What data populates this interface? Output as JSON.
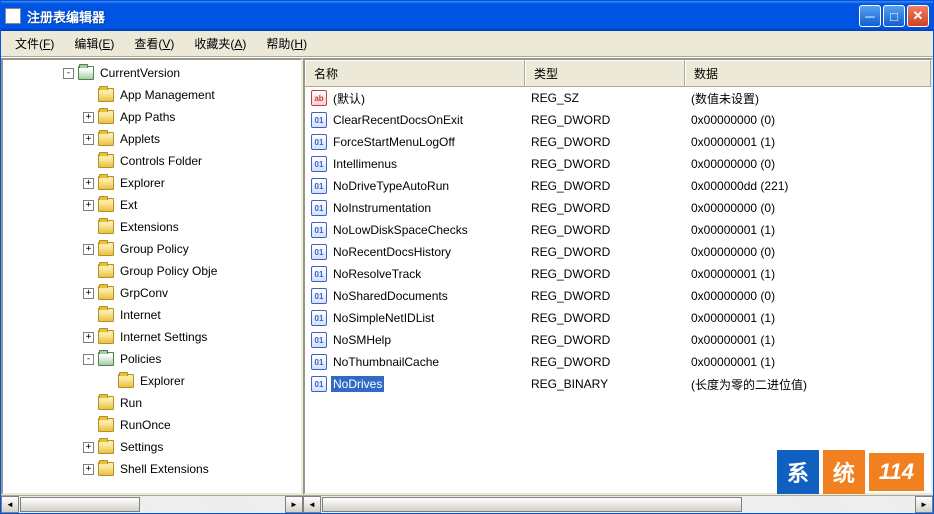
{
  "window": {
    "title": "注册表编辑器"
  },
  "menu": [
    {
      "label": "文件",
      "key": "F"
    },
    {
      "label": "编辑",
      "key": "E"
    },
    {
      "label": "查看",
      "key": "V"
    },
    {
      "label": "收藏夹",
      "key": "A"
    },
    {
      "label": "帮助",
      "key": "H"
    }
  ],
  "tree": [
    {
      "depth": 1,
      "toggle": "-",
      "open": true,
      "label": "CurrentVersion"
    },
    {
      "depth": 2,
      "toggle": "",
      "open": false,
      "label": "App Management"
    },
    {
      "depth": 2,
      "toggle": "+",
      "open": false,
      "label": "App Paths"
    },
    {
      "depth": 2,
      "toggle": "+",
      "open": false,
      "label": "Applets"
    },
    {
      "depth": 2,
      "toggle": "",
      "open": false,
      "label": "Controls Folder"
    },
    {
      "depth": 2,
      "toggle": "+",
      "open": false,
      "label": "Explorer"
    },
    {
      "depth": 2,
      "toggle": "+",
      "open": false,
      "label": "Ext"
    },
    {
      "depth": 2,
      "toggle": "",
      "open": false,
      "label": "Extensions"
    },
    {
      "depth": 2,
      "toggle": "+",
      "open": false,
      "label": "Group Policy"
    },
    {
      "depth": 2,
      "toggle": "",
      "open": false,
      "label": "Group Policy Obje"
    },
    {
      "depth": 2,
      "toggle": "+",
      "open": false,
      "label": "GrpConv"
    },
    {
      "depth": 2,
      "toggle": "",
      "open": false,
      "label": "Internet"
    },
    {
      "depth": 2,
      "toggle": "+",
      "open": false,
      "label": "Internet Settings"
    },
    {
      "depth": 2,
      "toggle": "-",
      "open": true,
      "label": "Policies"
    },
    {
      "depth": 3,
      "toggle": "",
      "open": false,
      "label": "Explorer"
    },
    {
      "depth": 2,
      "toggle": "",
      "open": false,
      "label": "Run"
    },
    {
      "depth": 2,
      "toggle": "",
      "open": false,
      "label": "RunOnce"
    },
    {
      "depth": 2,
      "toggle": "+",
      "open": false,
      "label": "Settings"
    },
    {
      "depth": 2,
      "toggle": "+",
      "open": false,
      "label": "Shell Extensions"
    }
  ],
  "columns": {
    "name": "名称",
    "type": "类型",
    "data": "数据"
  },
  "values": [
    {
      "icon": "sz",
      "name": "(默认)",
      "type": "REG_SZ",
      "data": "(数值未设置)",
      "selected": false
    },
    {
      "icon": "bin",
      "name": "ClearRecentDocsOnExit",
      "type": "REG_DWORD",
      "data": "0x00000000 (0)",
      "selected": false
    },
    {
      "icon": "bin",
      "name": "ForceStartMenuLogOff",
      "type": "REG_DWORD",
      "data": "0x00000001 (1)",
      "selected": false
    },
    {
      "icon": "bin",
      "name": "Intellimenus",
      "type": "REG_DWORD",
      "data": "0x00000000 (0)",
      "selected": false
    },
    {
      "icon": "bin",
      "name": "NoDriveTypeAutoRun",
      "type": "REG_DWORD",
      "data": "0x000000dd (221)",
      "selected": false
    },
    {
      "icon": "bin",
      "name": "NoInstrumentation",
      "type": "REG_DWORD",
      "data": "0x00000000 (0)",
      "selected": false
    },
    {
      "icon": "bin",
      "name": "NoLowDiskSpaceChecks",
      "type": "REG_DWORD",
      "data": "0x00000001 (1)",
      "selected": false
    },
    {
      "icon": "bin",
      "name": "NoRecentDocsHistory",
      "type": "REG_DWORD",
      "data": "0x00000000 (0)",
      "selected": false
    },
    {
      "icon": "bin",
      "name": "NoResolveTrack",
      "type": "REG_DWORD",
      "data": "0x00000001 (1)",
      "selected": false
    },
    {
      "icon": "bin",
      "name": "NoSharedDocuments",
      "type": "REG_DWORD",
      "data": "0x00000000 (0)",
      "selected": false
    },
    {
      "icon": "bin",
      "name": "NoSimpleNetIDList",
      "type": "REG_DWORD",
      "data": "0x00000001 (1)",
      "selected": false
    },
    {
      "icon": "bin",
      "name": "NoSMHelp",
      "type": "REG_DWORD",
      "data": "0x00000001 (1)",
      "selected": false
    },
    {
      "icon": "bin",
      "name": "NoThumbnailCache",
      "type": "REG_DWORD",
      "data": "0x00000001 (1)",
      "selected": false
    },
    {
      "icon": "bin",
      "name": "NoDrives",
      "type": "REG_BINARY",
      "data": "(长度为零的二进位值)",
      "selected": true
    }
  ],
  "watermark": {
    "t1": "系",
    "t2": "统",
    "t3": "114"
  }
}
